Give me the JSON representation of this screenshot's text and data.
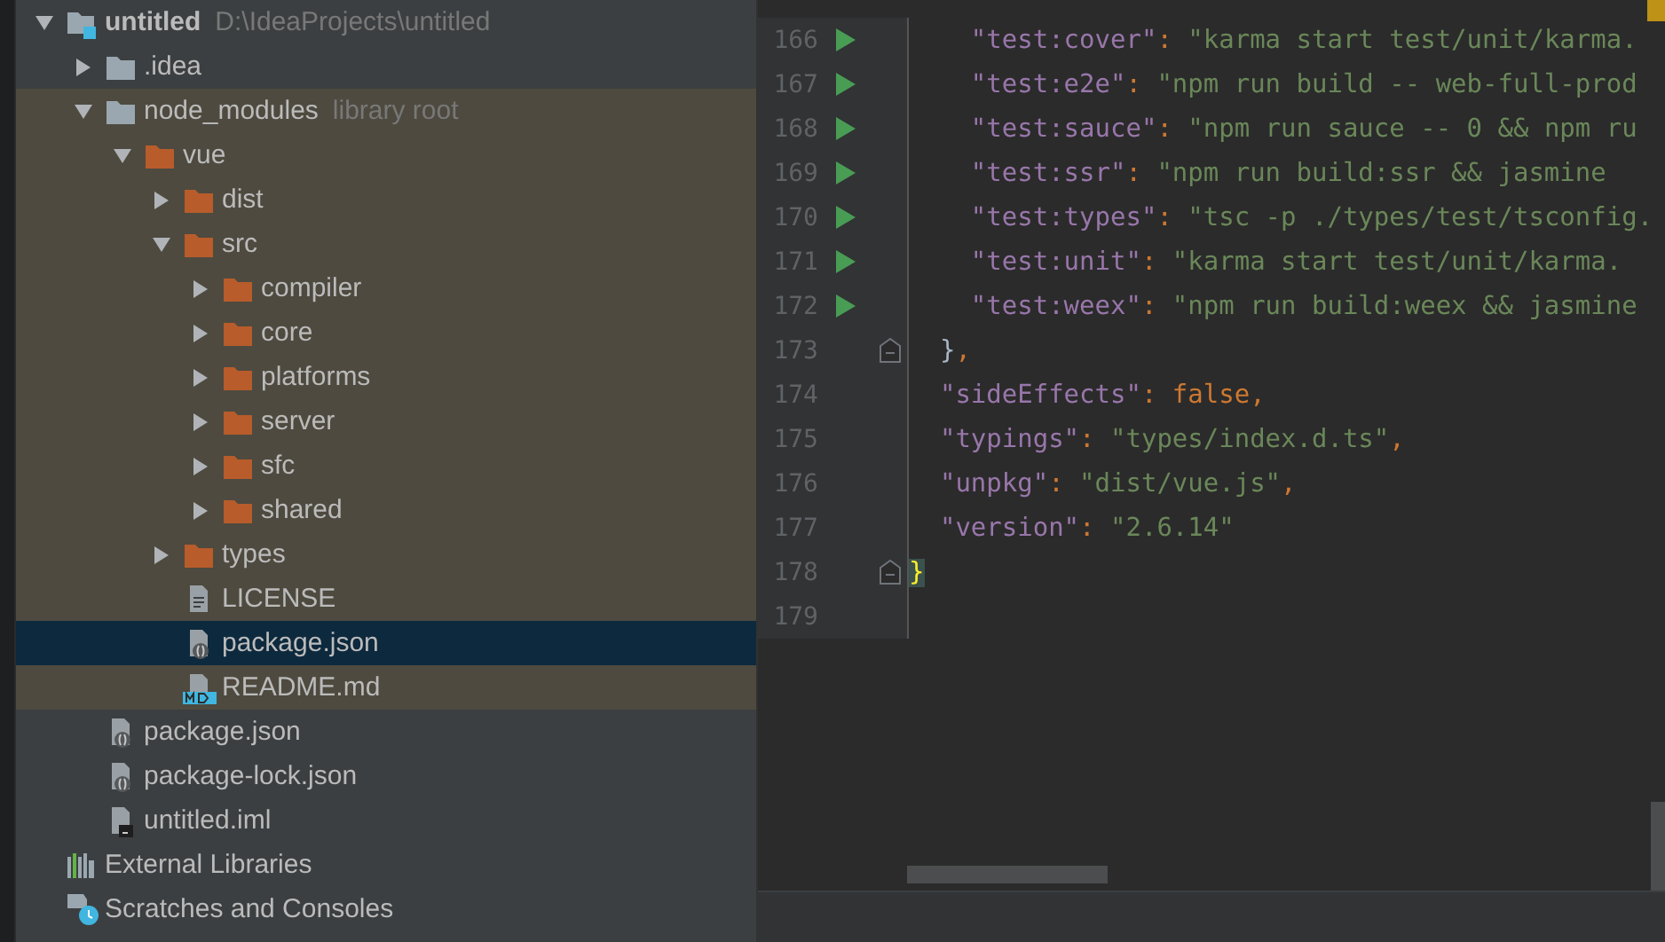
{
  "project_tree": [
    {
      "label": "untitled",
      "hint": "D:\\IdeaProjects\\untitled",
      "kind": "project",
      "expanded": true,
      "selected": false,
      "children": [
        {
          "label": ".idea",
          "kind": "folder",
          "library": false,
          "expanded": false,
          "selected": false
        },
        {
          "label": "node_modules",
          "hint": "library root",
          "kind": "folder",
          "library": true,
          "expanded": true,
          "selected": false,
          "children": [
            {
              "label": "vue",
              "kind": "library-folder",
              "expanded": true,
              "selected": false,
              "children": [
                {
                  "label": "dist",
                  "kind": "library-folder",
                  "expanded": false,
                  "selected": false
                },
                {
                  "label": "src",
                  "kind": "library-folder",
                  "expanded": true,
                  "selected": false,
                  "children": [
                    {
                      "label": "compiler",
                      "kind": "library-folder",
                      "expanded": false,
                      "selected": false
                    },
                    {
                      "label": "core",
                      "kind": "library-folder",
                      "expanded": false,
                      "selected": false
                    },
                    {
                      "label": "platforms",
                      "kind": "library-folder",
                      "expanded": false,
                      "selected": false
                    },
                    {
                      "label": "server",
                      "kind": "library-folder",
                      "expanded": false,
                      "selected": false
                    },
                    {
                      "label": "sfc",
                      "kind": "library-folder",
                      "expanded": false,
                      "selected": false
                    },
                    {
                      "label": "shared",
                      "kind": "library-folder",
                      "expanded": false,
                      "selected": false
                    }
                  ]
                },
                {
                  "label": "types",
                  "kind": "library-folder",
                  "expanded": false,
                  "selected": false
                },
                {
                  "label": "LICENSE",
                  "kind": "text-file",
                  "selected": false
                },
                {
                  "label": "package.json",
                  "kind": "json-file",
                  "selected": true
                },
                {
                  "label": "README.md",
                  "kind": "md-file",
                  "selected": false
                }
              ]
            }
          ]
        },
        {
          "label": "package.json",
          "kind": "json-file",
          "library": false,
          "selected": false
        },
        {
          "label": "package-lock.json",
          "kind": "json-file",
          "library": false,
          "selected": false
        },
        {
          "label": "untitled.iml",
          "kind": "iml-file",
          "library": false,
          "selected": false
        }
      ]
    },
    {
      "label": "External Libraries",
      "kind": "libraries",
      "selected": false
    },
    {
      "label": "Scratches and Consoles",
      "kind": "scratches",
      "selected": false
    }
  ],
  "editor": {
    "lines": [
      {
        "number": "166",
        "run": true,
        "fold": false,
        "tokens": [
          {
            "kind": "key",
            "text": "    \"test:cover\""
          },
          {
            "kind": "punct",
            "text": ": "
          },
          {
            "kind": "string",
            "text": "\"karma start test/unit/karma."
          }
        ]
      },
      {
        "number": "167",
        "run": true,
        "fold": false,
        "tokens": [
          {
            "kind": "key",
            "text": "    \"test:e2e\""
          },
          {
            "kind": "punct",
            "text": ": "
          },
          {
            "kind": "string",
            "text": "\"npm run build -- web-full-prod"
          }
        ]
      },
      {
        "number": "168",
        "run": true,
        "fold": false,
        "tokens": [
          {
            "kind": "key",
            "text": "    \"test:sauce\""
          },
          {
            "kind": "punct",
            "text": ": "
          },
          {
            "kind": "string",
            "text": "\"npm run sauce -- 0 && npm ru"
          }
        ]
      },
      {
        "number": "169",
        "run": true,
        "fold": false,
        "tokens": [
          {
            "kind": "key",
            "text": "    \"test:ssr\""
          },
          {
            "kind": "punct",
            "text": ": "
          },
          {
            "kind": "string",
            "text": "\"npm run build:ssr && jasmine"
          }
        ]
      },
      {
        "number": "170",
        "run": true,
        "fold": false,
        "tokens": [
          {
            "kind": "key",
            "text": "    \"test:types\""
          },
          {
            "kind": "punct",
            "text": ": "
          },
          {
            "kind": "string",
            "text": "\"tsc -p ./types/test/tsconfig."
          }
        ]
      },
      {
        "number": "171",
        "run": true,
        "fold": false,
        "tokens": [
          {
            "kind": "key",
            "text": "    \"test:unit\""
          },
          {
            "kind": "punct",
            "text": ": "
          },
          {
            "kind": "string",
            "text": "\"karma start test/unit/karma."
          }
        ]
      },
      {
        "number": "172",
        "run": true,
        "fold": false,
        "tokens": [
          {
            "kind": "key",
            "text": "    \"test:weex\""
          },
          {
            "kind": "punct",
            "text": ": "
          },
          {
            "kind": "string",
            "text": "\"npm run build:weex && jasmine"
          }
        ]
      },
      {
        "number": "173",
        "run": false,
        "fold": true,
        "tokens": [
          {
            "kind": "brace",
            "text": "  }"
          },
          {
            "kind": "punct",
            "text": ","
          }
        ]
      },
      {
        "number": "174",
        "run": false,
        "fold": false,
        "tokens": [
          {
            "kind": "key",
            "text": "  \"sideEffects\""
          },
          {
            "kind": "punct",
            "text": ": "
          },
          {
            "kind": "keyword",
            "text": "false"
          },
          {
            "kind": "punct",
            "text": ","
          }
        ]
      },
      {
        "number": "175",
        "run": false,
        "fold": false,
        "tokens": [
          {
            "kind": "key",
            "text": "  \"typings\""
          },
          {
            "kind": "punct",
            "text": ": "
          },
          {
            "kind": "string",
            "text": "\"types/index.d.ts\""
          },
          {
            "kind": "punct",
            "text": ","
          }
        ]
      },
      {
        "number": "176",
        "run": false,
        "fold": false,
        "tokens": [
          {
            "kind": "key",
            "text": "  \"unpkg\""
          },
          {
            "kind": "punct",
            "text": ": "
          },
          {
            "kind": "string",
            "text": "\"dist/vue.js\""
          },
          {
            "kind": "punct",
            "text": ","
          }
        ]
      },
      {
        "number": "177",
        "run": false,
        "fold": false,
        "tokens": [
          {
            "kind": "key",
            "text": "  \"version\""
          },
          {
            "kind": "punct",
            "text": ": "
          },
          {
            "kind": "string",
            "text": "\"2.6.14\""
          }
        ]
      },
      {
        "number": "178",
        "run": false,
        "fold": true,
        "tokens": [
          {
            "kind": "brace-match",
            "text": "}"
          }
        ]
      },
      {
        "number": "179",
        "run": false,
        "fold": false
      }
    ]
  }
}
